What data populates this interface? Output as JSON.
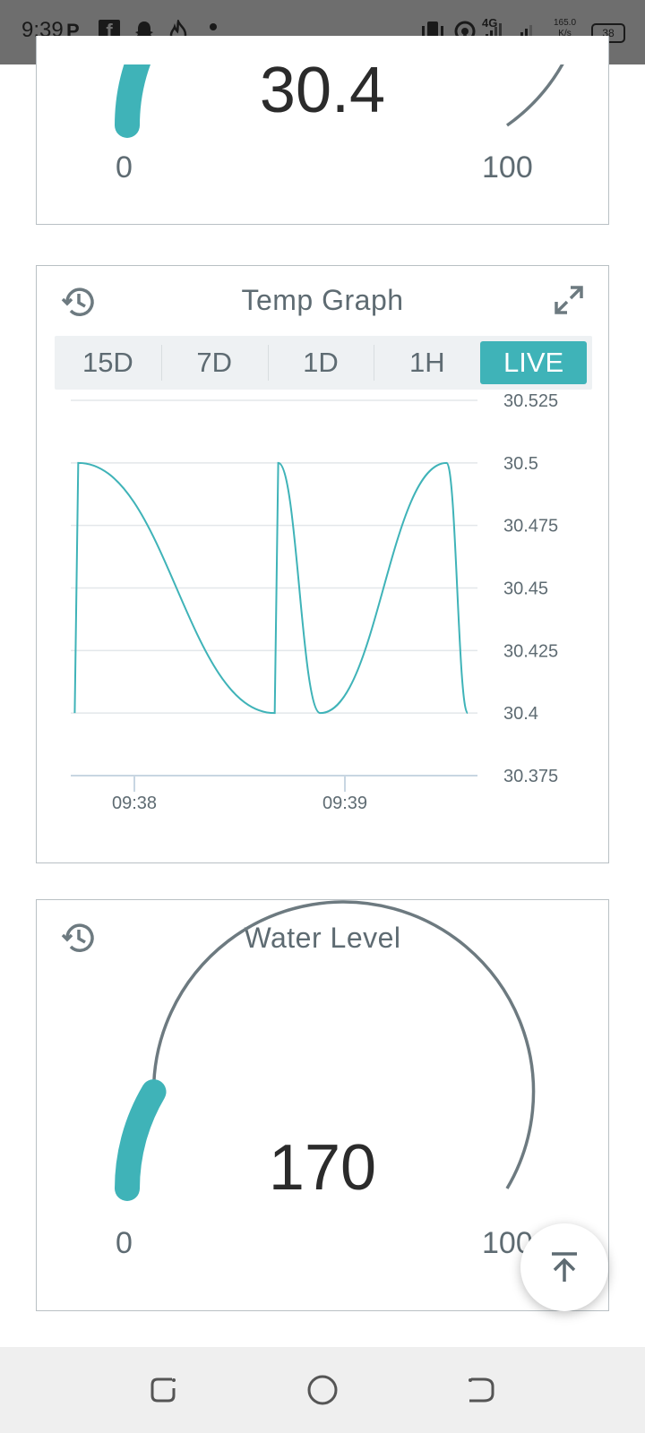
{
  "status_bar": {
    "time": "9:39",
    "app_icons": [
      "parking-icon",
      "facebook-icon",
      "snapchat-icon",
      "flame-icon",
      "dot-icon"
    ],
    "network_type": "4G",
    "speed_value": "165.0",
    "speed_unit": "K/s",
    "battery": "38"
  },
  "temperature_gauge": {
    "value": "30.4",
    "min_label": "0",
    "max_label": "100",
    "fraction": 0.304
  },
  "temp_graph": {
    "title": "Temp Graph",
    "range_tabs": [
      "15D",
      "7D",
      "1D",
      "1H",
      "LIVE"
    ],
    "active_tab": "LIVE",
    "y_tick_labels": [
      "30.525",
      "30.5",
      "30.475",
      "30.45",
      "30.425",
      "30.4",
      "30.375"
    ],
    "x_tick_labels": [
      "09:38",
      "09:39"
    ]
  },
  "chart_data": {
    "type": "line",
    "title": "Temp Graph",
    "xlabel": "",
    "ylabel": "",
    "ylim": [
      30.375,
      30.525
    ],
    "y_ticks": [
      30.375,
      30.4,
      30.425,
      30.45,
      30.475,
      30.5,
      30.525
    ],
    "x_ticks": [
      "09:38",
      "09:39"
    ],
    "grid": true,
    "series": [
      {
        "color": "#3fb3b8",
        "points": [
          {
            "t": "09:37:43",
            "y": 30.4
          },
          {
            "t": "09:37:44",
            "y": 30.5
          },
          {
            "t": "09:38:40",
            "y": 30.4
          },
          {
            "t": "09:38:41",
            "y": 30.5
          },
          {
            "t": "09:38:53",
            "y": 30.4
          },
          {
            "t": "09:39:29",
            "y": 30.5
          },
          {
            "t": "09:39:35",
            "y": 30.4
          }
        ]
      }
    ]
  },
  "water_level": {
    "title": "Water Level",
    "value": "170",
    "min_label": "0",
    "max_label": "100",
    "fraction": 0.17
  },
  "colors": {
    "accent": "#3fb3b8",
    "arc_track": "#6d7a80",
    "text_secondary": "#5e6b72",
    "status_bar": "#6e6e6e"
  },
  "scroll_top_button": {
    "icon": "arrow-up-to-top-icon"
  },
  "nav_bar": {
    "buttons": [
      "recent-apps-icon",
      "home-icon",
      "back-icon"
    ]
  }
}
